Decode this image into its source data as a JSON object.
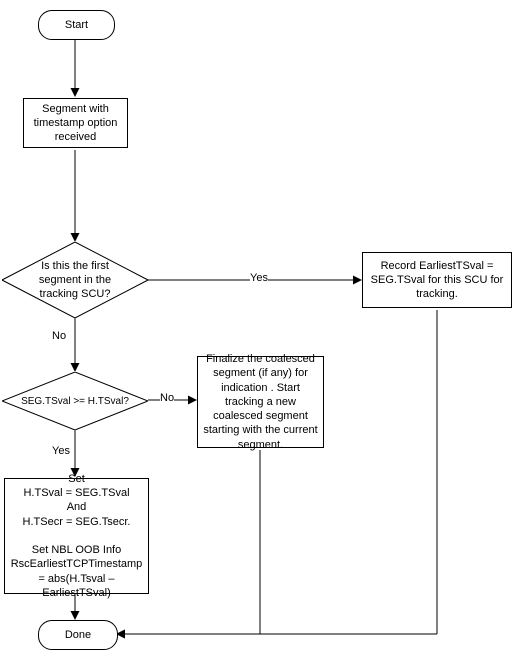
{
  "nodes": {
    "start": "Start",
    "segment_received": "Segment with timestamp option received",
    "first_segment_q": "Is this the first segment in the tracking   SCU?",
    "record_earliest": "Record EarliestTSval  = SEG.TSval for this SCU for tracking.",
    "tsval_compare_q": "SEG.TSval   >=  H.TSval?",
    "finalize": "Finalize the coalesced segment (if any) for indication . Start tracking a new coalesced segment starting with the current segment.",
    "set_block": "Set\nH.TSval = SEG.TSval\nAnd\nH.TSecr = SEG.Tsecr.\n\nSet NBL OOB Info RscEarliestTCPTimestamp = abs(H.Tsval – EarliestTSval)",
    "done": "Done"
  },
  "labels": {
    "yes1": "Yes",
    "no1": "No",
    "yes2": "Yes",
    "no2": "No"
  }
}
